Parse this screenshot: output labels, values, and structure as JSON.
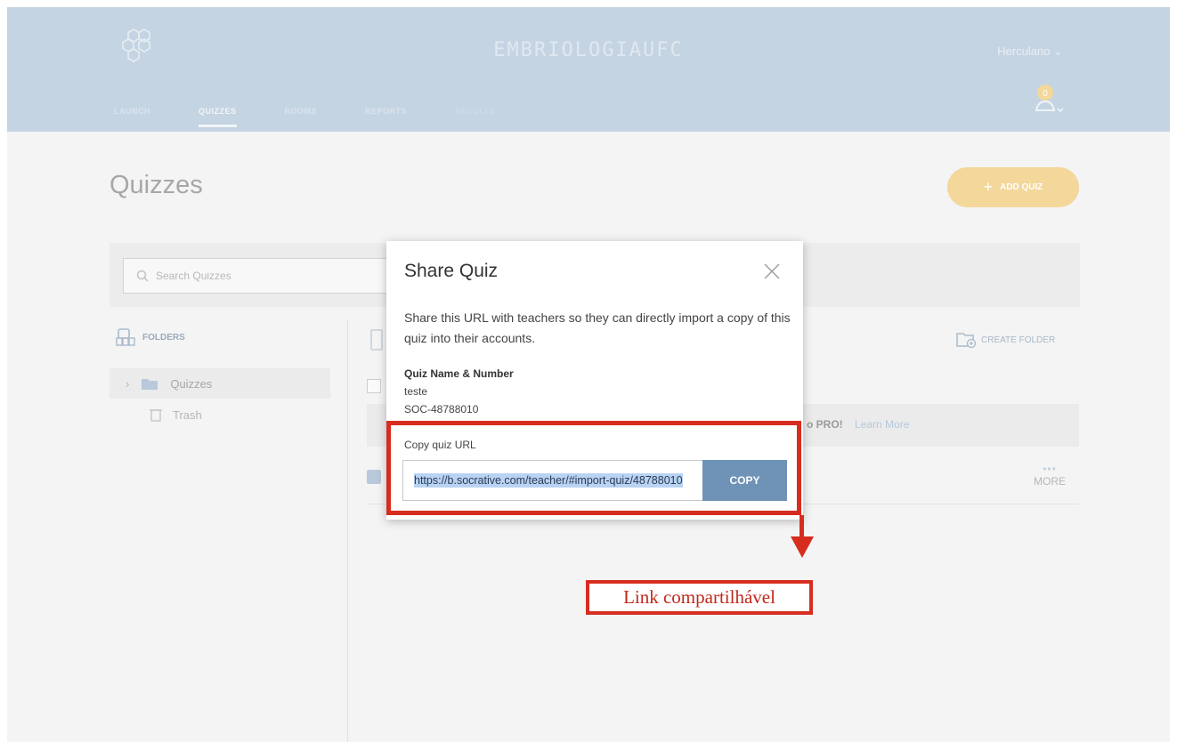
{
  "header": {
    "school_name": "EMBRIOLOGIAUFC",
    "user_name": "Herculano",
    "notification_count": "0",
    "nav": [
      "LAUNCH",
      "QUIZZES",
      "ROOMS",
      "REPORTS",
      "RESULTS"
    ]
  },
  "page": {
    "title": "Quizzes",
    "add_quiz_label": "ADD QUIZ",
    "search_placeholder": "Search Quizzes",
    "folders_label": "FOLDERS",
    "folders": [
      "Quizzes",
      "Trash"
    ],
    "create_folder_label": "CREATE FOLDER",
    "promo_text": "o PRO!",
    "promo_link": "Learn More",
    "more_label": "MORE"
  },
  "modal": {
    "title": "Share Quiz",
    "description": "Share this URL with teachers so they can directly import a copy of this quiz into their accounts.",
    "quiz_name_label": "Quiz Name & Number",
    "quiz_name": "teste",
    "quiz_number": "SOC-48788010",
    "copy_url_label": "Copy quiz URL",
    "url_value": "https://b.socrative.com/teacher/#import-quiz/48788010",
    "copy_button": "COPY"
  },
  "annotation": {
    "label": "Link compartilhável",
    "color": "#d72d1f"
  },
  "colors": {
    "header_bg": "#c5d4e2",
    "accent_orange": "#f3d79b",
    "copy_button": "#6f92b7"
  }
}
